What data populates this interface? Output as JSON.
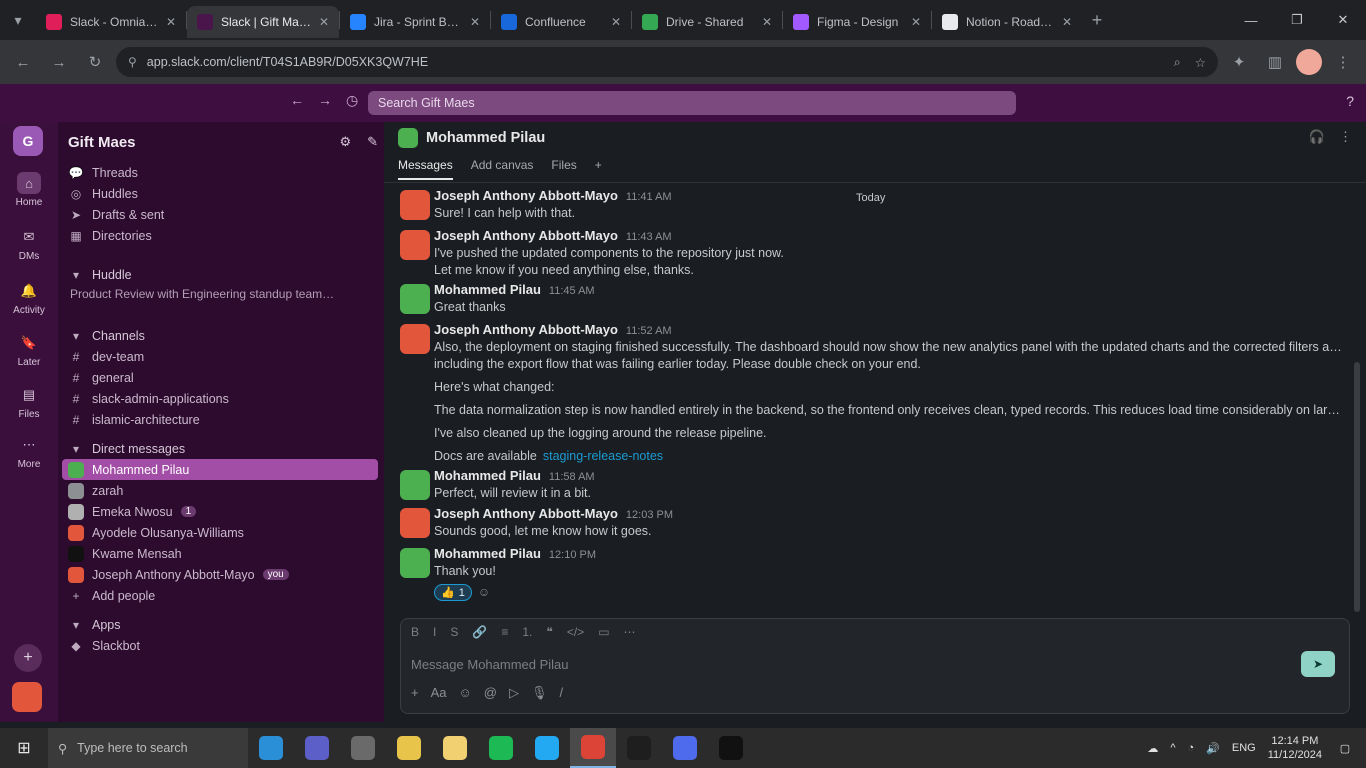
{
  "browser": {
    "tabs": [
      {
        "label": "Slack - Omnia Health",
        "color": "#e01e5a",
        "active": false
      },
      {
        "label": "Slack | Gift Maes Hosp…",
        "color": "#4a154b",
        "active": true
      },
      {
        "label": "Jira - Sprint Board",
        "color": "#2684ff",
        "active": false
      },
      {
        "label": "Confluence",
        "color": "#1868db",
        "active": false
      },
      {
        "label": "Drive - Shared",
        "color": "#34a853",
        "active": false
      },
      {
        "label": "Figma - Design",
        "color": "#a259ff",
        "active": false
      },
      {
        "label": "Notion - Roadmap",
        "color": "#e8eaed",
        "active": false
      }
    ],
    "new_tab": "+",
    "url": "app.slack.com/client/T04S1AB9R/D05XK3QW7HE"
  },
  "slack": {
    "search_placeholder": "Search Gift Maes",
    "workspace": {
      "initial": "G",
      "name": "Gift Maes"
    },
    "rail": [
      {
        "label": "Home",
        "icon": "⌂"
      },
      {
        "label": "DMs",
        "icon": "✉"
      },
      {
        "label": "Activity",
        "icon": "🔔"
      },
      {
        "label": "Later",
        "icon": "🔖"
      },
      {
        "label": "Files",
        "icon": "▤"
      },
      {
        "label": "More",
        "icon": "⋯"
      }
    ],
    "sidebar": {
      "top_links": [
        {
          "icon": "💬",
          "label": "Threads"
        },
        {
          "icon": "◎",
          "label": "Huddles"
        },
        {
          "icon": "➤",
          "label": "Drafts & sent"
        },
        {
          "icon": "▦",
          "label": "Directories"
        }
      ],
      "huddle_section": {
        "label": "Huddle",
        "sub": "Product Review with Engineering standup team…"
      },
      "channels_header": "Channels",
      "channels": [
        "dev-team",
        "general",
        "slack-admin-applications",
        "islamic-architecture"
      ],
      "dm_header": "Direct messages",
      "dms": [
        {
          "label": "Mohammed Pilau",
          "color": "#4caf50",
          "badge": ""
        },
        {
          "label": "zarah",
          "color": "#8d9093",
          "badge": ""
        },
        {
          "label": "Emeka Nwosu",
          "color": "#b0b0b0",
          "badge": "1"
        },
        {
          "label": "Ayodele Olusanya-Williams",
          "color": "#e2563b",
          "badge": ""
        },
        {
          "label": "Kwame Mensah",
          "color": "#111111",
          "badge": ""
        },
        {
          "label": "Joseph Anthony Abbott-Mayo",
          "color": "#e2563b",
          "badge": "you"
        }
      ],
      "add_people": "Add people",
      "apps_header": "Apps",
      "apps": [
        "Slackbot"
      ]
    },
    "channel": {
      "name": "Mohammed Pilau",
      "tabs": [
        "Messages",
        "Add canvas",
        "Files",
        "+"
      ],
      "tooltip": "Today"
    },
    "messages": [
      {
        "author": "Joseph Anthony Abbott-Mayo",
        "time": "11:41 AM",
        "avatar": "orange",
        "lines": [
          "Sure! I can help with that."
        ]
      },
      {
        "author": "Joseph Anthony Abbott-Mayo",
        "time": "11:43 AM",
        "avatar": "orange",
        "lines": [
          "I've pushed the updated components to the repository just now.",
          "Let me know if you need anything else, thanks."
        ]
      },
      {
        "author": "Mohammed Pilau",
        "time": "11:45 AM",
        "avatar": "green",
        "lines": [
          "Great thanks"
        ]
      },
      {
        "author": "Joseph Anthony Abbott-Mayo",
        "time": "11:52 AM",
        "avatar": "orange",
        "lines": [
          "Also, the deployment on staging finished successfully. The dashboard should now show the new analytics panel with the updated charts and the corrected filters across every view,",
          "including the export flow that was failing earlier today. Please double check on your end.",
          "Here's what changed:",
          "The data normalization step is now handled entirely in the backend, so the frontend only receives clean, typed records. This reduces load time considerably on large datasets.",
          "I've also cleaned up the logging around the release pipeline.",
          "Docs are available"
        ],
        "link_word": "pipeline",
        "link_line_index": 3,
        "doc_link": "staging-release-notes"
      },
      {
        "author": "Mohammed Pilau",
        "time": "11:58 AM",
        "avatar": "green",
        "lines": [
          "Perfect, will review it in a bit."
        ]
      },
      {
        "author": "Joseph Anthony Abbott-Mayo",
        "time": "12:03 PM",
        "avatar": "orange",
        "lines": [
          "Sounds good, let me know how it goes."
        ]
      },
      {
        "author": "Mohammed Pilau",
        "time": "12:10 PM",
        "avatar": "green",
        "lines": [
          "Thank you!"
        ],
        "reaction": {
          "emoji": "👍",
          "count": "1"
        }
      }
    ],
    "composer": {
      "format_icons": [
        "B",
        "I",
        "S",
        "🔗",
        "≡",
        "1.",
        "❝",
        "</>",
        "▭",
        "⋯"
      ],
      "placeholder": "Message Mohammed Pilau",
      "tools": [
        "+",
        "Aa",
        "☺",
        "@",
        "▷",
        "🎙",
        "/"
      ],
      "send": "➤"
    }
  },
  "taskbar": {
    "search_placeholder": "Type here to search",
    "apps": [
      {
        "name": "edge",
        "color": "#2b8fd8"
      },
      {
        "name": "teams",
        "color": "#5b5fc7"
      },
      {
        "name": "task-view",
        "color": "#6a6a6a"
      },
      {
        "name": "file-explorer",
        "color": "#e8c54a"
      },
      {
        "name": "mail",
        "color": "#f0d070"
      },
      {
        "name": "spotify",
        "color": "#1db954"
      },
      {
        "name": "vscode",
        "color": "#23a9f2"
      },
      {
        "name": "chrome",
        "color": "#db4437"
      },
      {
        "name": "terminal",
        "color": "#1e1e1e"
      },
      {
        "name": "photos",
        "color": "#4f6bed"
      },
      {
        "name": "github",
        "color": "#111111"
      }
    ],
    "tray": {
      "language": "ENG",
      "time": "12:14 PM",
      "date": "11/12/2024"
    }
  }
}
